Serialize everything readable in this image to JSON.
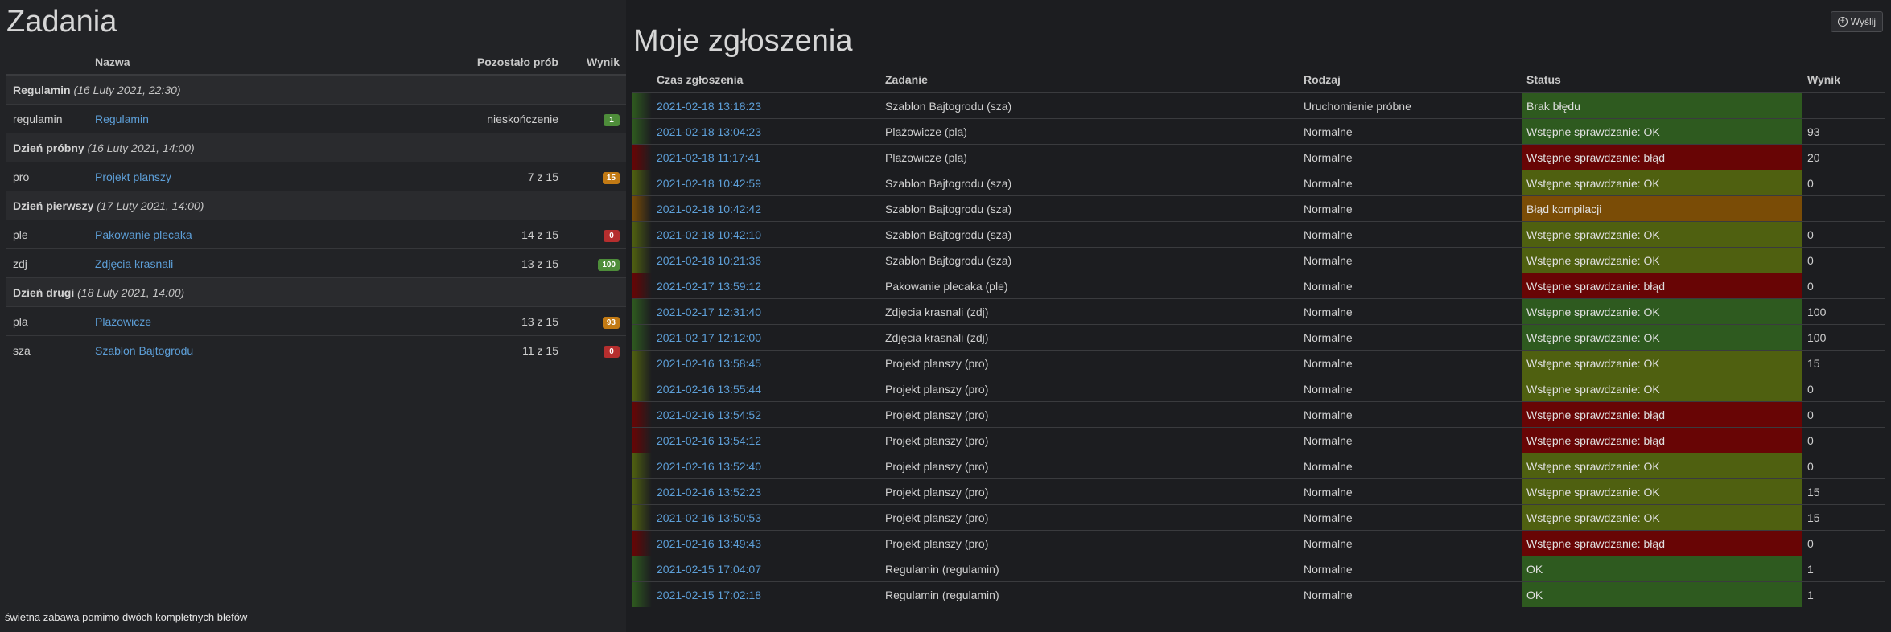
{
  "left": {
    "title": "Zadania",
    "headers": {
      "name": "Nazwa",
      "attempts": "Pozostało prób",
      "score": "Wynik"
    },
    "groups": [
      {
        "name": "Regulamin",
        "date": "(16 Luty 2021, 22:30)",
        "tasks": [
          {
            "code": "regulamin",
            "name": "Regulamin",
            "attempts": "nieskończenie",
            "score": "1",
            "color": "#4e8d3a"
          }
        ]
      },
      {
        "name": "Dzień próbny",
        "date": "(16 Luty 2021, 14:00)",
        "tasks": [
          {
            "code": "pro",
            "name": "Projekt planszy",
            "attempts": "7 z 15",
            "score": "15",
            "color": "#c27a14"
          }
        ]
      },
      {
        "name": "Dzień pierwszy",
        "date": "(17 Luty 2021, 14:00)",
        "tasks": [
          {
            "code": "ple",
            "name": "Pakowanie plecaka",
            "attempts": "14 z 15",
            "score": "0",
            "color": "#b52e2e"
          },
          {
            "code": "zdj",
            "name": "Zdjęcia krasnali",
            "attempts": "13 z 15",
            "score": "100",
            "color": "#4e8d3a"
          }
        ]
      },
      {
        "name": "Dzień drugi",
        "date": "(18 Luty 2021, 14:00)",
        "tasks": [
          {
            "code": "pla",
            "name": "Plażowicze",
            "attempts": "13 z 15",
            "score": "93",
            "color": "#c27a14"
          },
          {
            "code": "sza",
            "name": "Szablon Bajtogrodu",
            "attempts": "11 z 15",
            "score": "0",
            "color": "#b52e2e"
          }
        ]
      }
    ],
    "footnote": "świetna zabawa pomimo dwóch kompletnych blefów"
  },
  "right": {
    "title": "Moje zgłoszenia",
    "send_label": "Wyślij",
    "headers": {
      "time": "Czas zgłoszenia",
      "task": "Zadanie",
      "kind": "Rodzaj",
      "status": "Status",
      "score": "Wynik"
    },
    "colors": {
      "green": "#2e5a1f",
      "olive": "#4f6010",
      "red": "#680505",
      "orange": "#7a4c06"
    },
    "submissions": [
      {
        "time": "2021-02-18 13:18:23",
        "task": "Szablon Bajtogrodu (sza)",
        "kind": "Uruchomienie próbne",
        "status": "Brak błędu",
        "score": "",
        "tone": "green"
      },
      {
        "time": "2021-02-18 13:04:23",
        "task": "Plażowicze (pla)",
        "kind": "Normalne",
        "status": "Wstępne sprawdzanie: OK",
        "score": "93",
        "tone": "green"
      },
      {
        "time": "2021-02-18 11:17:41",
        "task": "Plażowicze (pla)",
        "kind": "Normalne",
        "status": "Wstępne sprawdzanie: błąd",
        "score": "20",
        "tone": "red"
      },
      {
        "time": "2021-02-18 10:42:59",
        "task": "Szablon Bajtogrodu (sza)",
        "kind": "Normalne",
        "status": "Wstępne sprawdzanie: OK",
        "score": "0",
        "tone": "olive"
      },
      {
        "time": "2021-02-18 10:42:42",
        "task": "Szablon Bajtogrodu (sza)",
        "kind": "Normalne",
        "status": "Błąd kompilacji",
        "score": "",
        "tone": "orange"
      },
      {
        "time": "2021-02-18 10:42:10",
        "task": "Szablon Bajtogrodu (sza)",
        "kind": "Normalne",
        "status": "Wstępne sprawdzanie: OK",
        "score": "0",
        "tone": "olive"
      },
      {
        "time": "2021-02-18 10:21:36",
        "task": "Szablon Bajtogrodu (sza)",
        "kind": "Normalne",
        "status": "Wstępne sprawdzanie: OK",
        "score": "0",
        "tone": "olive"
      },
      {
        "time": "2021-02-17 13:59:12",
        "task": "Pakowanie plecaka (ple)",
        "kind": "Normalne",
        "status": "Wstępne sprawdzanie: błąd",
        "score": "0",
        "tone": "red"
      },
      {
        "time": "2021-02-17 12:31:40",
        "task": "Zdjęcia krasnali (zdj)",
        "kind": "Normalne",
        "status": "Wstępne sprawdzanie: OK",
        "score": "100",
        "tone": "green"
      },
      {
        "time": "2021-02-17 12:12:00",
        "task": "Zdjęcia krasnali (zdj)",
        "kind": "Normalne",
        "status": "Wstępne sprawdzanie: OK",
        "score": "100",
        "tone": "green"
      },
      {
        "time": "2021-02-16 13:58:45",
        "task": "Projekt planszy (pro)",
        "kind": "Normalne",
        "status": "Wstępne sprawdzanie: OK",
        "score": "15",
        "tone": "olive"
      },
      {
        "time": "2021-02-16 13:55:44",
        "task": "Projekt planszy (pro)",
        "kind": "Normalne",
        "status": "Wstępne sprawdzanie: OK",
        "score": "0",
        "tone": "olive"
      },
      {
        "time": "2021-02-16 13:54:52",
        "task": "Projekt planszy (pro)",
        "kind": "Normalne",
        "status": "Wstępne sprawdzanie: błąd",
        "score": "0",
        "tone": "red"
      },
      {
        "time": "2021-02-16 13:54:12",
        "task": "Projekt planszy (pro)",
        "kind": "Normalne",
        "status": "Wstępne sprawdzanie: błąd",
        "score": "0",
        "tone": "red"
      },
      {
        "time": "2021-02-16 13:52:40",
        "task": "Projekt planszy (pro)",
        "kind": "Normalne",
        "status": "Wstępne sprawdzanie: OK",
        "score": "0",
        "tone": "olive"
      },
      {
        "time": "2021-02-16 13:52:23",
        "task": "Projekt planszy (pro)",
        "kind": "Normalne",
        "status": "Wstępne sprawdzanie: OK",
        "score": "15",
        "tone": "olive"
      },
      {
        "time": "2021-02-16 13:50:53",
        "task": "Projekt planszy (pro)",
        "kind": "Normalne",
        "status": "Wstępne sprawdzanie: OK",
        "score": "15",
        "tone": "olive"
      },
      {
        "time": "2021-02-16 13:49:43",
        "task": "Projekt planszy (pro)",
        "kind": "Normalne",
        "status": "Wstępne sprawdzanie: błąd",
        "score": "0",
        "tone": "red"
      },
      {
        "time": "2021-02-15 17:04:07",
        "task": "Regulamin (regulamin)",
        "kind": "Normalne",
        "status": "OK",
        "score": "1",
        "tone": "green"
      },
      {
        "time": "2021-02-15 17:02:18",
        "task": "Regulamin (regulamin)",
        "kind": "Normalne",
        "status": "OK",
        "score": "1",
        "tone": "green"
      }
    ]
  }
}
